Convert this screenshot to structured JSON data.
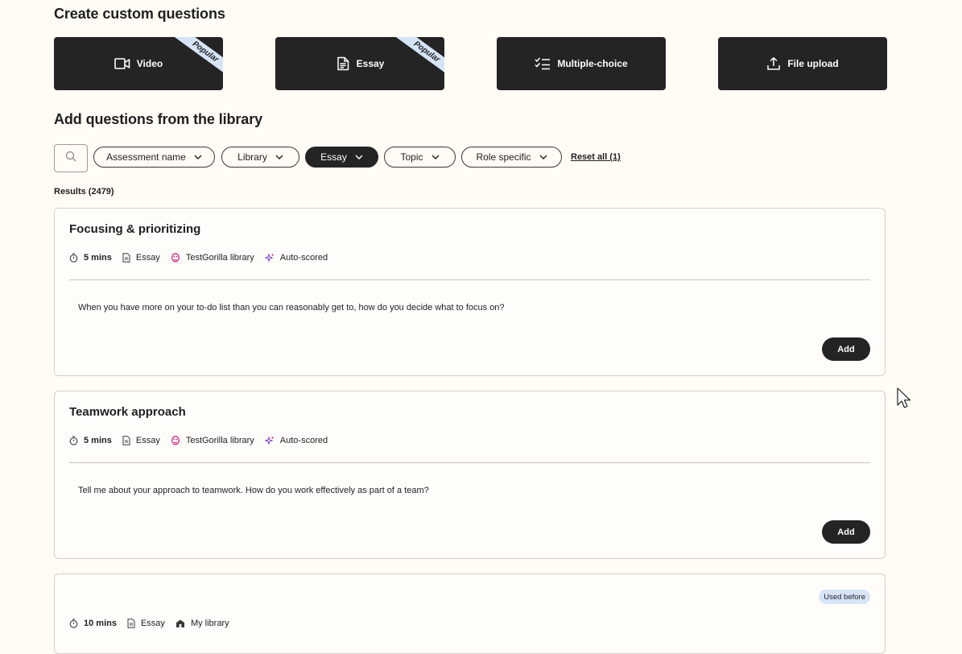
{
  "custom": {
    "heading": "Create custom questions",
    "types": [
      {
        "label": "Video",
        "ribbon": "Popular",
        "icon": "video-icon"
      },
      {
        "label": "Essay",
        "ribbon": "Popular",
        "icon": "document-icon"
      },
      {
        "label": "Multiple-choice",
        "icon": "checklist-icon"
      },
      {
        "label": "File upload",
        "icon": "upload-icon"
      }
    ]
  },
  "library": {
    "heading": "Add questions from the library",
    "search_icon": "search-icon",
    "filters": [
      {
        "label": "Assessment name",
        "active": false
      },
      {
        "label": "Library",
        "active": false
      },
      {
        "label": "Essay",
        "active": true
      },
      {
        "label": "Topic",
        "active": false
      },
      {
        "label": "Role specific",
        "active": false
      }
    ],
    "reset_label": "Reset all (1)",
    "results_label": "Results (2479)"
  },
  "cards": [
    {
      "title": "Focusing & prioritizing",
      "duration": "5 mins",
      "type": "Essay",
      "source": "TestGorilla library",
      "scoring": "Auto-scored",
      "question": "When you have more on your to-do list than you can reasonably get to, how do you decide what to focus on?",
      "add_label": "Add"
    },
    {
      "title": "Teamwork approach",
      "duration": "5 mins",
      "type": "Essay",
      "source": "TestGorilla library",
      "scoring": "Auto-scored",
      "question": "Tell me about your approach to teamwork. How do you work effectively as part of a team?",
      "add_label": "Add"
    },
    {
      "badge": "Used before",
      "duration": "10 mins",
      "type": "Essay",
      "source": "My library"
    }
  ],
  "colors": {
    "background": "#fffbf5",
    "dark": "#242424",
    "ribbon": "#d6e4f8",
    "accent_pink": "#d6287a"
  }
}
